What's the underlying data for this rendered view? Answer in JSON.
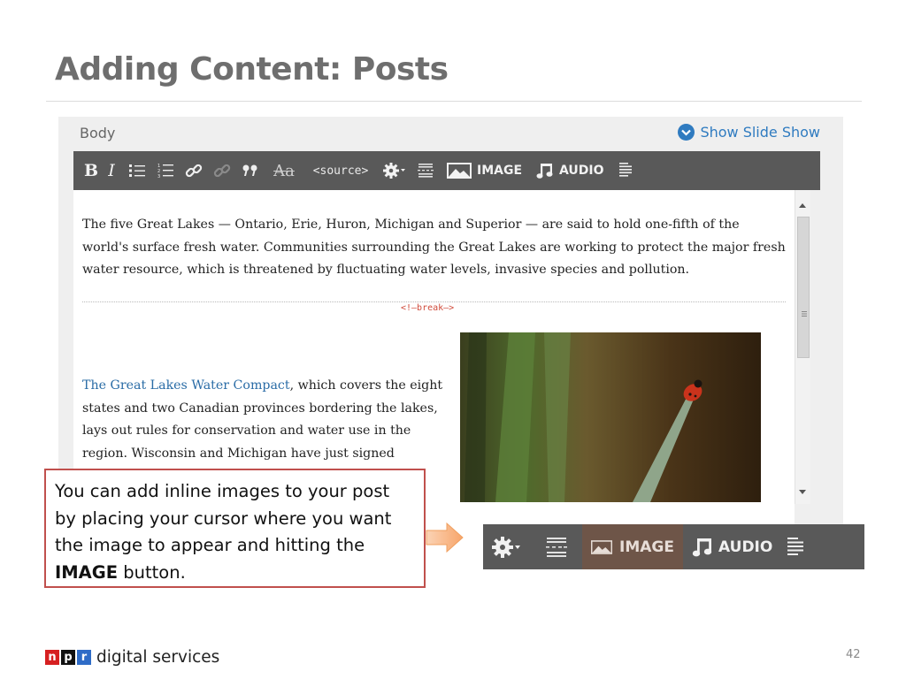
{
  "slide": {
    "title": "Adding Content: Posts",
    "page_number": "42"
  },
  "editor": {
    "body_label": "Body",
    "slideshow_label": "Show Slide Show",
    "toolbar": {
      "bold_label": "B",
      "italic_label": "I",
      "strike_label": "Aa",
      "source_label": "<source>",
      "image_label": "IMAGE",
      "audio_label": "AUDIO",
      "icons": [
        "bold-icon",
        "italic-icon",
        "bullet-list-icon",
        "numbered-list-icon",
        "link-icon",
        "unlink-icon",
        "blockquote-icon",
        "strikethrough-icon",
        "source-icon",
        "gear-icon",
        "page-break-icon",
        "image-icon",
        "audio-icon",
        "document-icon"
      ]
    },
    "paragraph1": "The five Great Lakes — Ontario, Erie, Huron, Michigan and Superior — are said to hold one-fifth of the world's surface fresh water. Communities surrounding the Great Lakes are working to protect the major fresh water resource, which is threatened by fluctuating water levels, invasive species and pollution.",
    "break_tag": "<!—break—>",
    "paragraph2": {
      "link_text": "The Great Lakes Water Compact",
      "text": ", which covers the eight states and two Canadian provinces bordering the lakes, lays out rules for conservation and water use in the region. Wisconsin and Michigan have just signed"
    },
    "inline_image": "ladybug-on-grass-photo"
  },
  "callout": {
    "text_before": "You can add inline images to your post by placing your cursor where you want the image to appear and hitting the ",
    "bold_word": "IMAGE",
    "text_after": " button."
  },
  "zoom_toolbar": {
    "image_label": "IMAGE",
    "audio_label": "AUDIO",
    "highlight_color": "#6e5548"
  },
  "footer": {
    "npr_letters": [
      "n",
      "p",
      "r"
    ],
    "brand_text": "digital services",
    "colors": {
      "n": "#d62021",
      "p": "#111111",
      "r": "#2f6cc7"
    }
  }
}
